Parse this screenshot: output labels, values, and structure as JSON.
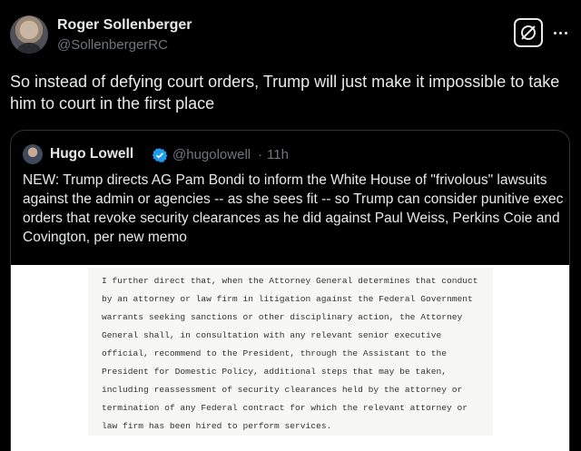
{
  "tweet": {
    "author_name": "Roger Sollenberger",
    "author_handle": "@SollenbergerRC",
    "text": "So instead of defying court orders, Trump will just make it impossible to take him to court in the first place",
    "icons": {
      "grok": "grok-icon",
      "more": "more-icon"
    }
  },
  "quote": {
    "author_name": "Hugo Lowell",
    "author_handle": "@hugolowell",
    "separator": "·",
    "time": "11h",
    "text": "NEW: Trump directs AG Pam Bondi to inform the White House of \"frivolous\" lawsuits against the admin or agencies -- as she sees fit -- so Trump can consider punitive exec orders that revoke security clearances as he did against Paul Weiss, Perkins Coie and Covington, per new memo",
    "document_lines": [
      "I further direct that, when the Attorney General determines that conduct",
      "by an attorney or law firm in litigation against the Federal Government",
      "warrants seeking sanctions or other disciplinary action, the Attorney",
      "General shall, in consultation with any relevant senior executive",
      "official, recommend to the President, through the Assistant to the",
      "President for Domestic Policy, additional steps that may be taken,",
      "including reassessment of security clearances held by the attorney or",
      "termination of any Federal contract for which the relevant attorney or",
      "law firm has been hired to perform services."
    ],
    "verified_color": "#1d9bf0"
  }
}
